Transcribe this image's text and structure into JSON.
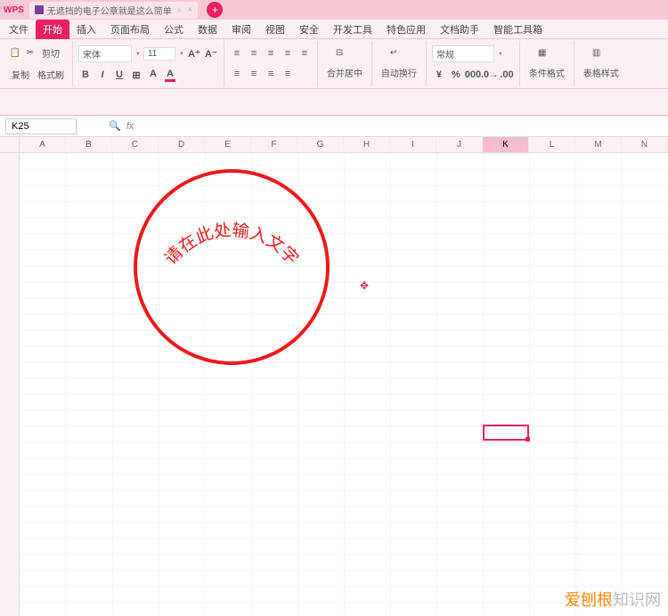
{
  "title_bar": {
    "app_name": "WPS",
    "tab_title": "无遮挡的电子公章就是这么简单",
    "tab_close_glyph": "×",
    "add_glyph": "+"
  },
  "menu": {
    "file": "文件",
    "items": [
      "开始",
      "插入",
      "页面布局",
      "公式",
      "数据",
      "审阅",
      "视图",
      "安全",
      "开发工具",
      "特色应用",
      "文档助手",
      "智能工具箱"
    ],
    "active_index": 0
  },
  "ribbon": {
    "clipboard": {
      "cut": "剪切",
      "copy": "复制",
      "format_painter": "格式刷"
    },
    "font": {
      "name": "宋体",
      "size": "11",
      "bold": "B",
      "italic": "I",
      "underline": "U",
      "font_color": "#e91e63",
      "fill_color": "#ffeb3b"
    },
    "align": {
      "merge_center": "合并居中",
      "auto_wrap": "自动换行"
    },
    "number": {
      "format": "常规",
      "percent": "%"
    },
    "styles": {
      "cond_format": "条件格式",
      "table_style": "表格样式"
    }
  },
  "formula_bar": {
    "cell_ref": "K25",
    "fx_label": "fx"
  },
  "columns": [
    "A",
    "B",
    "C",
    "D",
    "E",
    "F",
    "G",
    "H",
    "I",
    "J",
    "K",
    "L",
    "M",
    "N"
  ],
  "active_column": "K",
  "stamp": {
    "arc_text": "请在此处输入文字"
  },
  "watermark": {
    "accent": "爱刨根",
    "rest": "知识网"
  }
}
